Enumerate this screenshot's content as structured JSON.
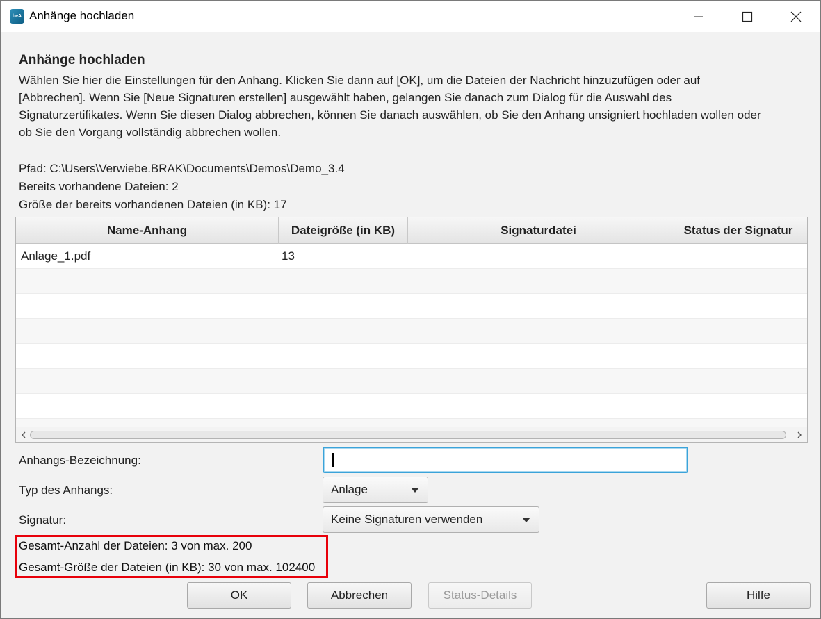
{
  "window": {
    "title": "Anhänge hochladen",
    "app_icon_text": "beA"
  },
  "header": {
    "title": "Anhänge hochladen",
    "description_lines": [
      "Wählen Sie hier die Einstellungen für den Anhang. Klicken Sie dann auf [OK], um die Dateien der Nachricht hinzuzufügen oder auf",
      "[Abbrechen]. Wenn Sie [Neue Signaturen erstellen] ausgewählt haben, gelangen Sie danach zum Dialog für die Auswahl des",
      "Signaturzertifikates. Wenn Sie diesen Dialog abbrechen, können Sie danach auswählen, ob Sie den Anhang unsigniert hochladen wollen oder",
      "ob Sie den Vorgang vollständig abbrechen wollen."
    ]
  },
  "info": {
    "path": "Pfad: C:\\Users\\Verwiebe.BRAK\\Documents\\Demos\\Demo_3.4",
    "existing_files": "Bereits vorhandene Dateien: 2",
    "existing_size": "Größe der bereits vorhandenen Dateien (in KB): 17"
  },
  "table": {
    "columns": [
      "Name-Anhang",
      "Dateigröße (in KB)",
      "Signaturdatei",
      "Status der Signatur"
    ],
    "rows": [
      [
        "Anlage_1.pdf",
        "13",
        "",
        ""
      ]
    ]
  },
  "form": {
    "name_label": "Anhangs-Bezeichnung:",
    "name_value": "",
    "type_label": "Typ des Anhangs:",
    "type_value": "Anlage",
    "signature_label": "Signatur:",
    "signature_value": "Keine Signaturen verwenden"
  },
  "totals": {
    "count": "Gesamt-Anzahl der Dateien: 3 von max. 200",
    "size": "Gesamt-Größe der Dateien (in KB): 30 von max. 102400"
  },
  "buttons": {
    "ok": "OK",
    "cancel": "Abbrechen",
    "status_details": "Status-Details",
    "help": "Hilfe"
  },
  "colors": {
    "highlight": "#e8000a",
    "focus": "#3ba3d9"
  }
}
